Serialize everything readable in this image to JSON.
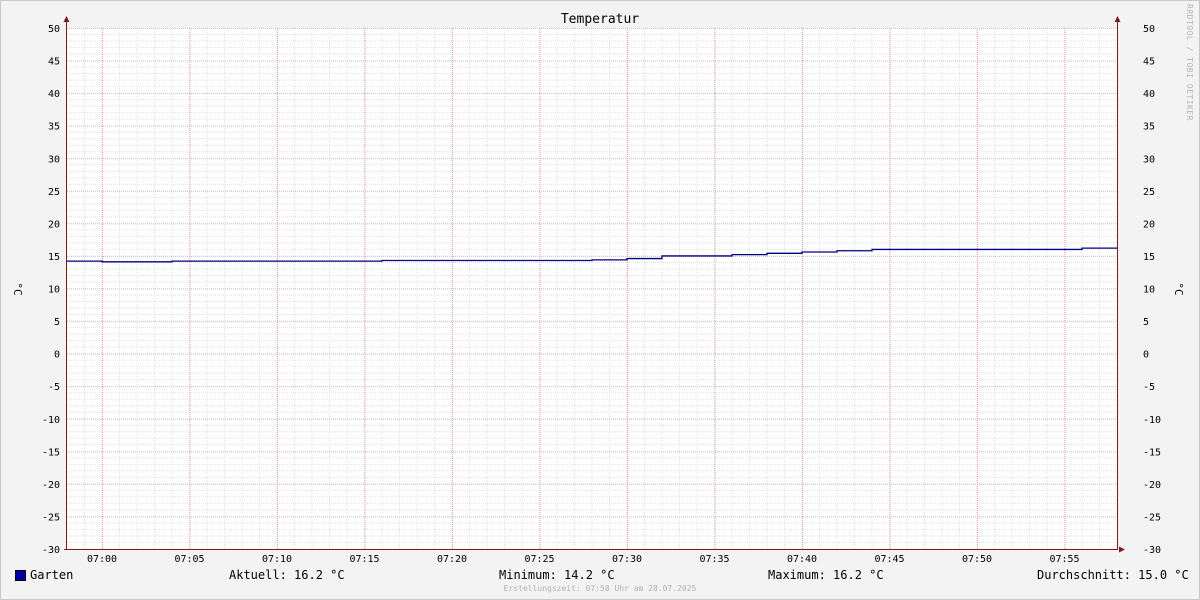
{
  "chart_data": {
    "type": "line",
    "title": "Temperatur",
    "ylabel": "°C",
    "ylabel_right": "°C",
    "ylim": [
      -30,
      50
    ],
    "y_ticks": [
      50,
      45,
      40,
      35,
      30,
      25,
      20,
      15,
      10,
      5,
      0,
      -5,
      -10,
      -15,
      -20,
      -25,
      -30
    ],
    "x_tick_labels": [
      "07:00",
      "07:05",
      "07:10",
      "07:15",
      "07:20",
      "07:25",
      "07:30",
      "07:35",
      "07:40",
      "07:45",
      "07:50",
      "07:55"
    ],
    "x_range": [
      "06:58",
      "07:58"
    ],
    "grid": true,
    "series": [
      {
        "name": "Garten",
        "color": "#000080",
        "step": true,
        "x": [
          "06:58",
          "07:00",
          "07:04",
          "07:16",
          "07:28",
          "07:30",
          "07:32",
          "07:36",
          "07:38",
          "07:40",
          "07:42",
          "07:44",
          "07:56",
          "07:58"
        ],
        "values": [
          14.2,
          14.1,
          14.2,
          14.3,
          14.4,
          14.6,
          15.0,
          15.2,
          15.4,
          15.6,
          15.8,
          16.0,
          16.2,
          16.2
        ]
      }
    ]
  },
  "legend": {
    "series_name": "Garten",
    "series_color": "#000080",
    "current": "Aktuell: 16.2 °C",
    "minimum": "Minimum: 14.2 °C",
    "maximum": "Maximum: 16.2 °C",
    "average": "Durchschnitt: 15.0 °C"
  },
  "footer": {
    "created": "Erstellungszeit: 07:58 Uhr am 28.07.2025"
  },
  "watermark": "RRDTOOL / TOBI OETIKER"
}
